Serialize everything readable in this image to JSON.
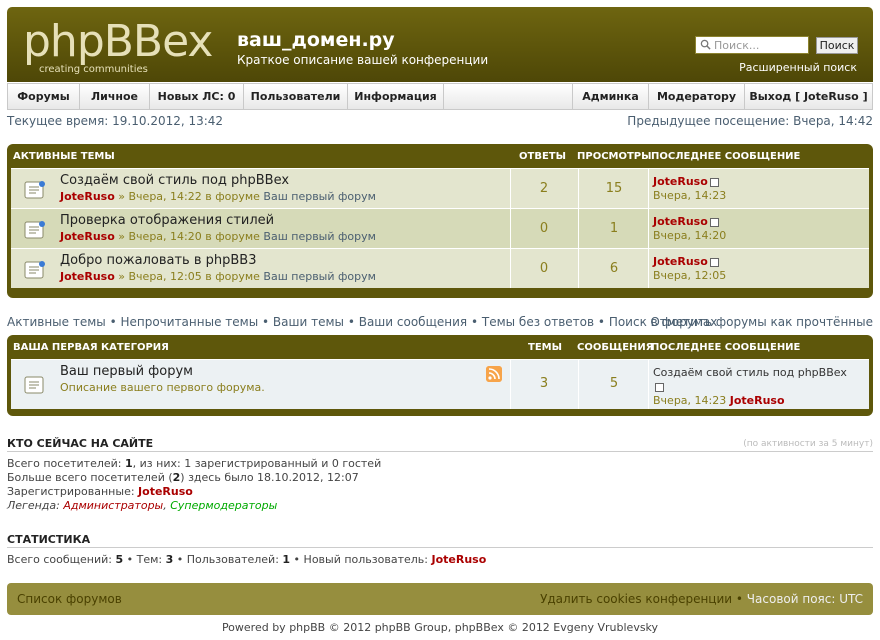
{
  "header": {
    "logo_text": "phpBBex",
    "logo_tagline": "creating communities",
    "site_title": "ваш_домен.ру",
    "site_desc": "Краткое описание вашей конференции",
    "search_placeholder": "Поиск...",
    "search_button": "Поиск",
    "advanced_search": "Расширенный поиск"
  },
  "nav": {
    "left": [
      "Форумы",
      "Личное",
      "Новых ЛС: 0",
      "Пользователи",
      "Информация"
    ],
    "right": [
      "Админка",
      "Модератору",
      "Выход [ JoteRuso ]"
    ]
  },
  "time": {
    "current": "Текущее время: 19.10.2012, 13:42",
    "last_visit": "Предыдущее посещение: Вчера, 14:42"
  },
  "active_topics": {
    "header": "АКТИВНЫЕ ТЕМЫ",
    "col_replies": "ОТВЕТЫ",
    "col_views": "ПРОСМОТРЫ",
    "col_last": "ПОСЛЕДНЕЕ СООБЩЕНИЕ",
    "rows": [
      {
        "title": "Создаём свой стиль под phpBBex",
        "author": "JoteRuso",
        "meta": " » Вчера, 14:22 в форуме ",
        "forum": "Ваш первый форум",
        "replies": "2",
        "views": "15",
        "last_author": "JoteRuso",
        "last_time": "Вчера, 14:23"
      },
      {
        "title": "Проверка отображения стилей",
        "author": "JoteRuso",
        "meta": " » Вчера, 14:20 в форуме ",
        "forum": "Ваш первый форум",
        "replies": "0",
        "views": "1",
        "last_author": "JoteRuso",
        "last_time": "Вчера, 14:20"
      },
      {
        "title": "Добро пожаловать в phpBB3",
        "author": "JoteRuso",
        "meta": " » Вчера, 12:05 в форуме ",
        "forum": "Ваш первый форум",
        "replies": "0",
        "views": "6",
        "last_author": "JoteRuso",
        "last_time": "Вчера, 12:05"
      }
    ]
  },
  "quick_links": {
    "items": [
      "Активные темы",
      "Непрочитанные темы",
      "Ваши темы",
      "Ваши сообщения",
      "Темы без ответов",
      "Поиск в форумах"
    ],
    "mark_read": "Отметить форумы как прочтённые"
  },
  "category": {
    "header": "ВАША ПЕРВАЯ КАТЕГОРИЯ",
    "col_topics": "ТЕМЫ",
    "col_posts": "СООБЩЕНИЯ",
    "col_last": "ПОСЛЕДНЕЕ СООБЩЕНИЕ",
    "forum": {
      "title": "Ваш первый форум",
      "desc": "Описание вашего первого форума.",
      "topics": "3",
      "posts": "5",
      "last_title": "Создаём свой стиль под phpBBex",
      "last_time": "Вчера, 14:23",
      "last_author": "JoteRuso"
    }
  },
  "online": {
    "title": "КТО СЕЙЧАС НА САЙТЕ",
    "note": "(по активности за 5 минут)",
    "line1_a": "Всего посетителей: ",
    "line1_n": "1",
    "line1_b": ", из них: 1 зарегистрированный и 0 гостей",
    "line2_a": "Больше всего посетителей (",
    "line2_n": "2",
    "line2_b": ") здесь было 18.10.2012, 12:07",
    "line3_a": "Зарегистрированные: ",
    "line3_user": "JoteRuso",
    "legend_a": "Легенда: ",
    "legend_admins": "Администраторы",
    "legend_sep": ", ",
    "legend_mods": "Супермодераторы"
  },
  "stats": {
    "title": "СТАТИСТИКА",
    "posts_label": "Всего сообщений: ",
    "posts": "5",
    "topics_label": " • Тем: ",
    "topics": "3",
    "users_label": " • Пользователей: ",
    "users": "1",
    "newest_label": " • Новый пользователь: ",
    "newest": "JoteRuso"
  },
  "footer": {
    "board_index": "Список форумов",
    "delete_cookies": "Удалить cookies конференции",
    "sep": " • ",
    "timezone": "Часовой пояс: UTC",
    "powered": "Powered by phpBB © 2012 phpBB Group, phpBBex © 2012 Evgeny Vrublevsky"
  },
  "colors": {
    "header_bg": "#5b530a",
    "user_red": "#a00000",
    "link_blue": "#4a5e70",
    "legend_admin": "#aa0000",
    "legend_mod": "#00aa00"
  }
}
